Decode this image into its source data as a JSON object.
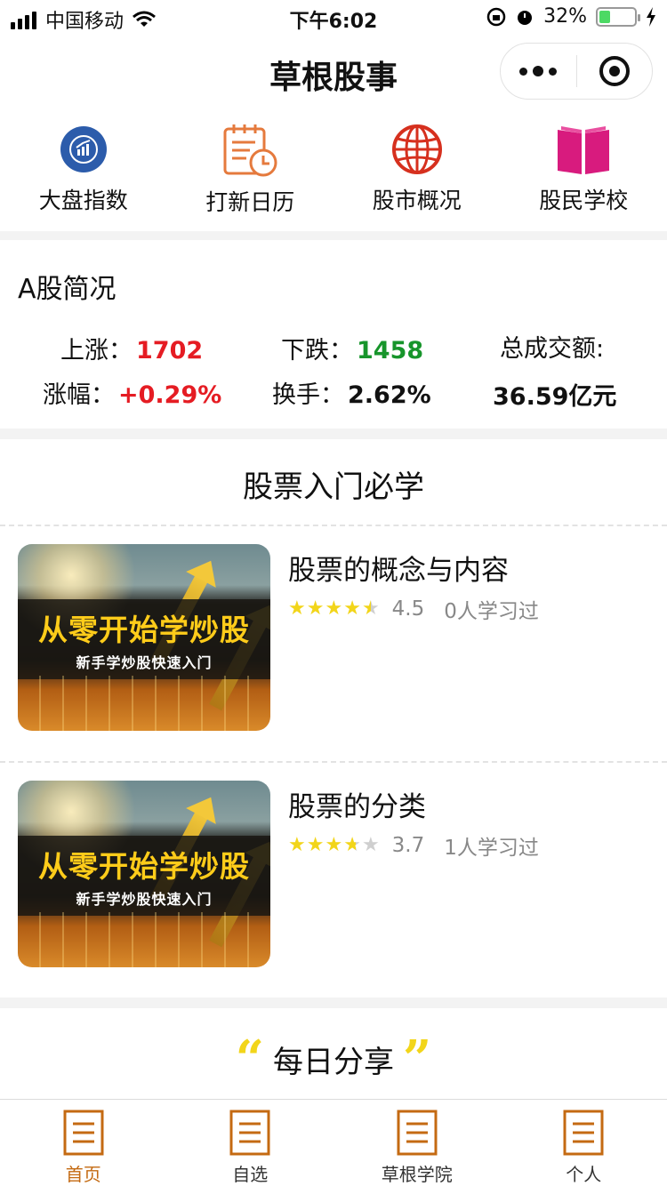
{
  "status_bar": {
    "carrier": "中国移动",
    "time": "下午6:02",
    "battery_percent": "32%",
    "battery_level": 0.32
  },
  "navbar": {
    "title": "草根股事"
  },
  "quick_nav": [
    {
      "label": "大盘指数",
      "icon": "chart-circle-icon"
    },
    {
      "label": "打新日历",
      "icon": "calendar-clock-icon"
    },
    {
      "label": "股市概况",
      "icon": "globe-icon"
    },
    {
      "label": "股民学校",
      "icon": "book-icon"
    }
  ],
  "summary": {
    "title": "A股简况",
    "rise_label": "上涨：",
    "rise_value": "1702",
    "fall_label": "下跌：",
    "fall_value": "1458",
    "turnover_total_label": "总成交额:",
    "change_label": "涨幅：",
    "change_value": "+0.29%",
    "turnover_rate_label": "换手：",
    "turnover_rate_value": "2.62%",
    "turnover_total_value": "36.59亿元"
  },
  "courses_section": {
    "title": "股票入门必学",
    "items": [
      {
        "title": "股票的概念与内容",
        "rating": 4.5,
        "score": "4.5",
        "learners": "0人学习过",
        "thumb_title": "从零开始学炒股",
        "thumb_subtitle": "新手学炒股快速入门"
      },
      {
        "title": "股票的分类",
        "rating": 3.7,
        "score": "3.7",
        "learners": "1人学习过",
        "thumb_title": "从零开始学炒股",
        "thumb_subtitle": "新手学炒股快速入门"
      }
    ]
  },
  "daily_share": {
    "title": "每日分享"
  },
  "tabbar": [
    {
      "label": "首页",
      "active": true
    },
    {
      "label": "自选",
      "active": false
    },
    {
      "label": "草根学院",
      "active": false
    },
    {
      "label": "个人",
      "active": false
    }
  ],
  "colors": {
    "rise": "#e51c23",
    "fall": "#17952b",
    "tab_active": "#c46a12",
    "star": "#f2d51a"
  }
}
